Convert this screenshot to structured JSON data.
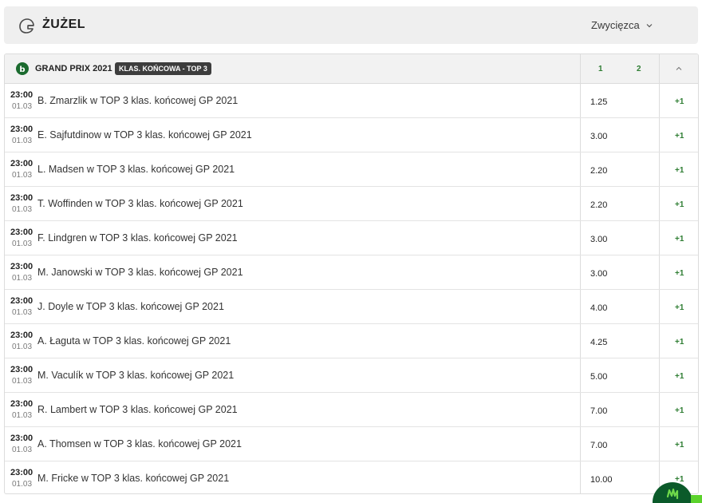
{
  "sport": {
    "title": "ŻUŻEL",
    "market_selected": "Zwycięzca"
  },
  "league": {
    "name": "GRAND PRIX 2021",
    "badge": "KLAS. KOŃCOWA - TOP 3",
    "col1": "1",
    "col2": "2"
  },
  "events": [
    {
      "time": "23:00",
      "date": "01.03",
      "name": "B. Zmarzlik w TOP 3 klas. końcowej GP 2021",
      "odd": "1.25",
      "more": "+1"
    },
    {
      "time": "23:00",
      "date": "01.03",
      "name": "E. Sajfutdinow w TOP 3 klas. końcowej GP 2021",
      "odd": "3.00",
      "more": "+1"
    },
    {
      "time": "23:00",
      "date": "01.03",
      "name": "L. Madsen w TOP 3 klas. końcowej GP 2021",
      "odd": "2.20",
      "more": "+1"
    },
    {
      "time": "23:00",
      "date": "01.03",
      "name": "T. Woffinden w TOP 3 klas. końcowej GP 2021",
      "odd": "2.20",
      "more": "+1"
    },
    {
      "time": "23:00",
      "date": "01.03",
      "name": "F. Lindgren w TOP 3 klas. końcowej GP 2021",
      "odd": "3.00",
      "more": "+1"
    },
    {
      "time": "23:00",
      "date": "01.03",
      "name": "M. Janowski w TOP 3 klas. końcowej GP 2021",
      "odd": "3.00",
      "more": "+1"
    },
    {
      "time": "23:00",
      "date": "01.03",
      "name": "J. Doyle w TOP 3 klas. końcowej GP 2021",
      "odd": "4.00",
      "more": "+1"
    },
    {
      "time": "23:00",
      "date": "01.03",
      "name": "A. Łaguta w TOP 3 klas. końcowej GP 2021",
      "odd": "4.25",
      "more": "+1"
    },
    {
      "time": "23:00",
      "date": "01.03",
      "name": "M. Vaculík w TOP 3 klas. końcowej GP 2021",
      "odd": "5.00",
      "more": "+1"
    },
    {
      "time": "23:00",
      "date": "01.03",
      "name": "R. Lambert w TOP 3 klas. końcowej GP 2021",
      "odd": "7.00",
      "more": "+1"
    },
    {
      "time": "23:00",
      "date": "01.03",
      "name": "A. Thomsen w TOP 3 klas. końcowej GP 2021",
      "odd": "7.00",
      "more": "+1"
    },
    {
      "time": "23:00",
      "date": "01.03",
      "name": "M. Fricke w TOP 3 klas. końcowej GP 2021",
      "odd": "10.00",
      "more": "+1"
    }
  ],
  "icons": {
    "sport": "helmet-icon",
    "league": "league-logo-icon",
    "dropdown": "chevron-down-icon",
    "collapse": "chevron-up-icon",
    "fab": "chat-fab-icon"
  },
  "colors": {
    "accent": "#2e7d32",
    "badge_bg": "#3d3d3d",
    "header_bg": "#efefef",
    "fab": "#0b5a2a"
  }
}
